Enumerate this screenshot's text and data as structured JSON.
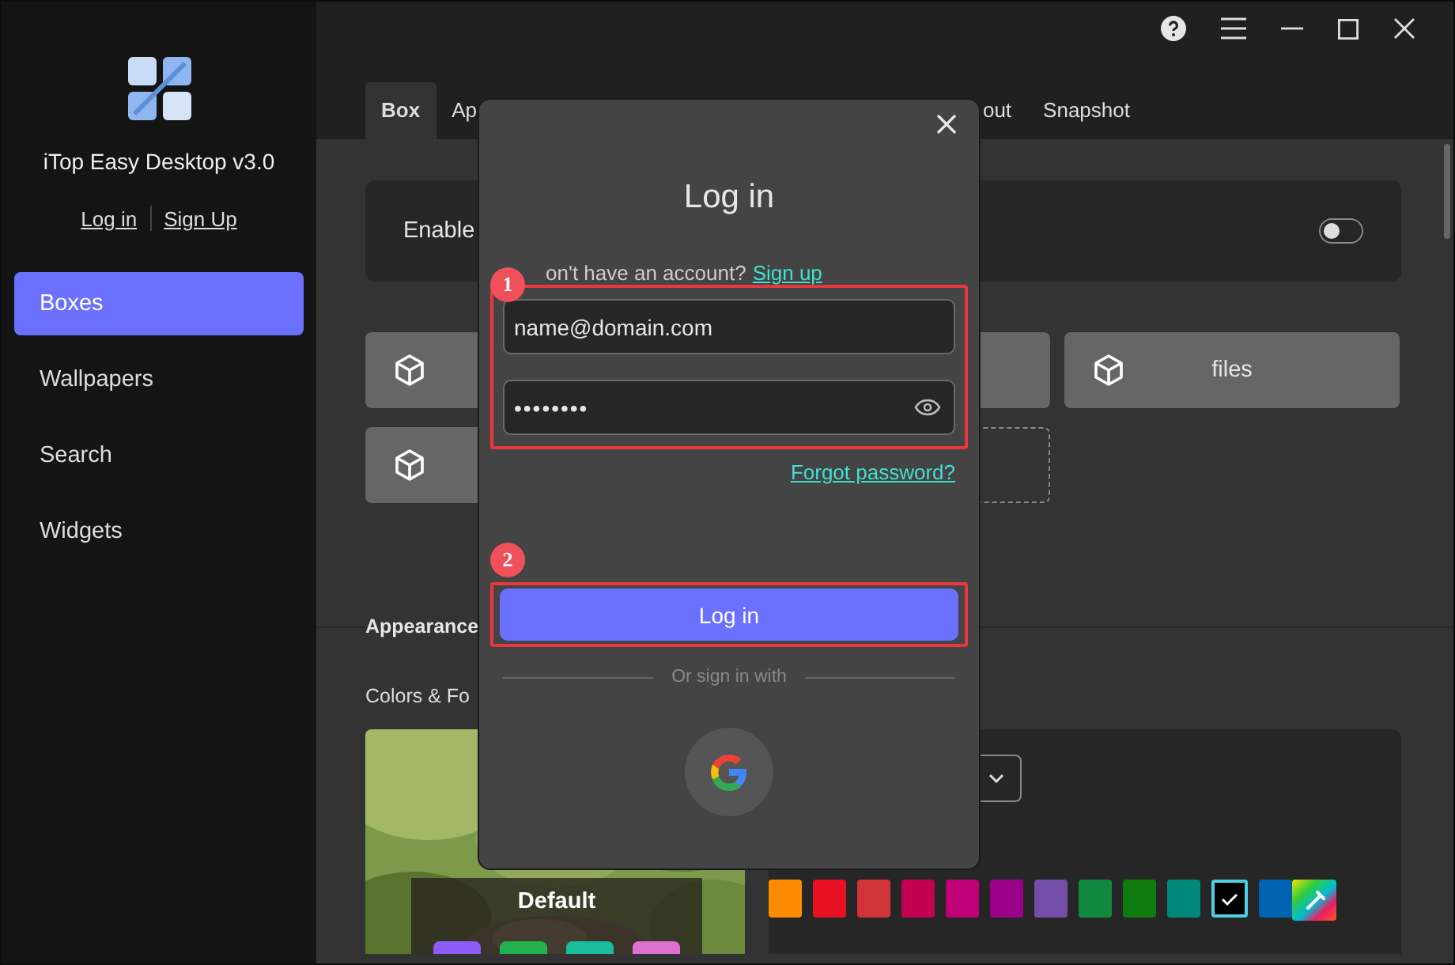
{
  "app": {
    "name": "iTop Easy Desktop v3.0",
    "links": [
      "Log in",
      "Sign Up"
    ]
  },
  "sidebar": {
    "items": [
      {
        "label": "Boxes",
        "selected": true
      },
      {
        "label": "Wallpapers",
        "selected": false
      },
      {
        "label": "Search",
        "selected": false
      },
      {
        "label": "Widgets",
        "selected": false
      }
    ]
  },
  "tabs": [
    {
      "label": "Box",
      "selected": true
    },
    {
      "label": "Ap",
      "selected": false
    },
    {
      "label": "out",
      "selected": false
    },
    {
      "label": "Snapshot",
      "selected": false
    }
  ],
  "enable_panel": {
    "label": "Enable",
    "on": false
  },
  "boxes": [
    {
      "kind": "tile"
    },
    {
      "kind": "plain"
    },
    {
      "kind": "tile",
      "label": "files"
    },
    {
      "kind": "tile"
    },
    {
      "kind": "dashed"
    }
  ],
  "appearance": {
    "heading": "Appearance",
    "subheading": "Colors & Fo",
    "preview": {
      "kind": "picture",
      "label": "Default",
      "chips": [
        {
          "color": "#8b5cf6"
        },
        {
          "color": "#22b14c"
        },
        {
          "color": "#1abc9c"
        },
        {
          "color": "#e070d0"
        }
      ]
    },
    "swatches": [
      {
        "color": "#ff8c00",
        "selected": false
      },
      {
        "color": "#e81123",
        "selected": false
      },
      {
        "color": "#d13438",
        "selected": false
      },
      {
        "color": "#c30052",
        "selected": false
      },
      {
        "color": "#bf0077",
        "selected": false
      },
      {
        "color": "#9a0089",
        "selected": false
      },
      {
        "color": "#744da9",
        "selected": false
      },
      {
        "color": "#10893e",
        "selected": false
      },
      {
        "color": "#107c10",
        "selected": false
      },
      {
        "color": "#00897b",
        "selected": false
      },
      {
        "color": "#000000",
        "selected": true
      },
      {
        "color": "#0063b1",
        "selected": false
      }
    ]
  },
  "login_dialog": {
    "title": "Log in",
    "prompt": "on't have an account?",
    "signup_link": "Sign up",
    "email": "name@domain.com",
    "password": "••••••••",
    "forgot_link": "Forgot password?",
    "button": "Log in",
    "divider": "Or sign in with",
    "markers": [
      "1",
      "2"
    ]
  }
}
